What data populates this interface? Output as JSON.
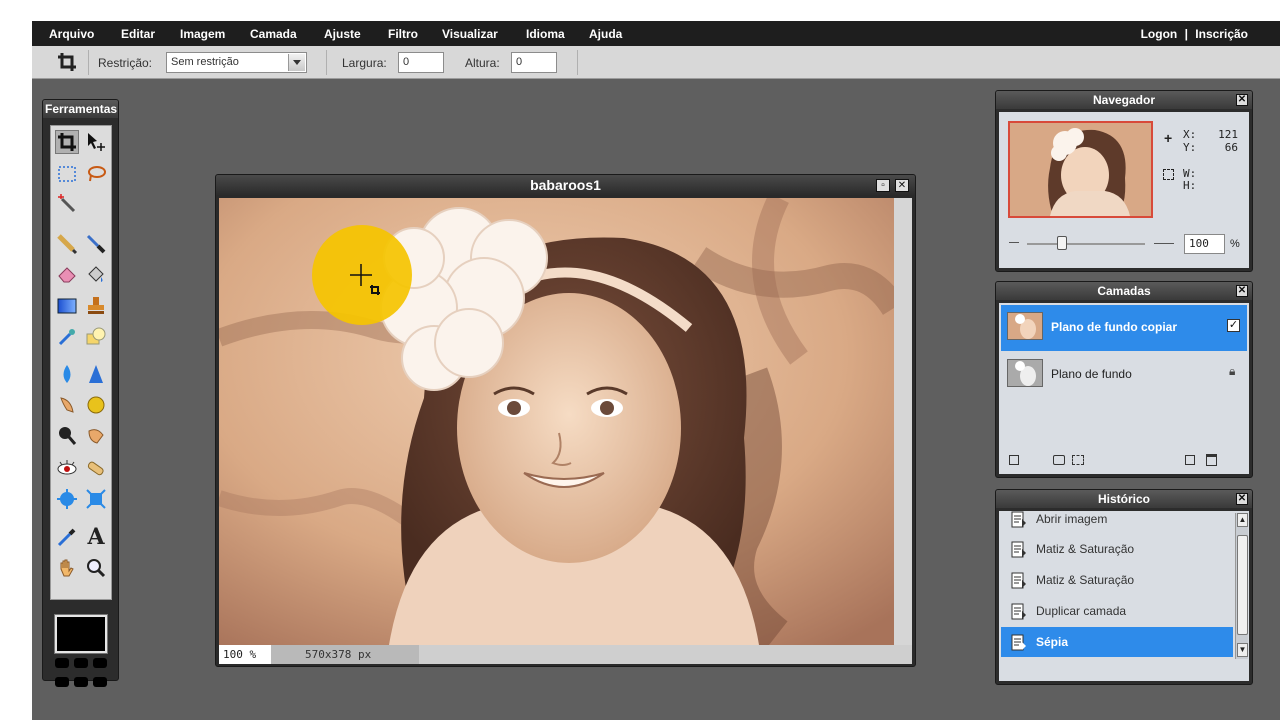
{
  "menubar": {
    "items": [
      "Arquivo",
      "Editar",
      "Imagem",
      "Camada",
      "Ajuste",
      "Filtro",
      "Visualizar",
      "Idioma",
      "Ajuda"
    ],
    "logon": "Logon",
    "separator": "|",
    "signup": "Inscrição"
  },
  "options": {
    "restriction_label": "Restrição:",
    "restriction_value": "Sem restrição",
    "width_label": "Largura:",
    "width_value": "0",
    "height_label": "Altura:",
    "height_value": "0"
  },
  "tools": {
    "title": "Ferramentas",
    "foreground_color": "#000000"
  },
  "document": {
    "title": "babaroos1",
    "zoom": "100 %",
    "dimensions": "570x378 px"
  },
  "navigator": {
    "title": "Navegador",
    "x_label": "X:",
    "x_value": "121",
    "y_label": "Y:",
    "y_value": "66",
    "w_label": "W:",
    "h_label": "H:",
    "zoom_value": "100",
    "zoom_unit": "%"
  },
  "layers": {
    "title": "Camadas",
    "items": [
      {
        "name": "Plano de fundo copiar",
        "selected": true
      },
      {
        "name": "Plano de fundo",
        "selected": false
      }
    ]
  },
  "history": {
    "title": "Histórico",
    "items": [
      {
        "label": "Abrir imagem"
      },
      {
        "label": "Matiz & Saturação"
      },
      {
        "label": "Matiz & Saturação"
      },
      {
        "label": "Duplicar camada"
      },
      {
        "label": "Sépia"
      }
    ],
    "selected_index": 4
  },
  "colors": {
    "accent": "#2e8bea",
    "sepia_light": "#e9c3a4",
    "sepia_dark": "#7a4f3c",
    "highlight_yellow": "#f5c400"
  }
}
